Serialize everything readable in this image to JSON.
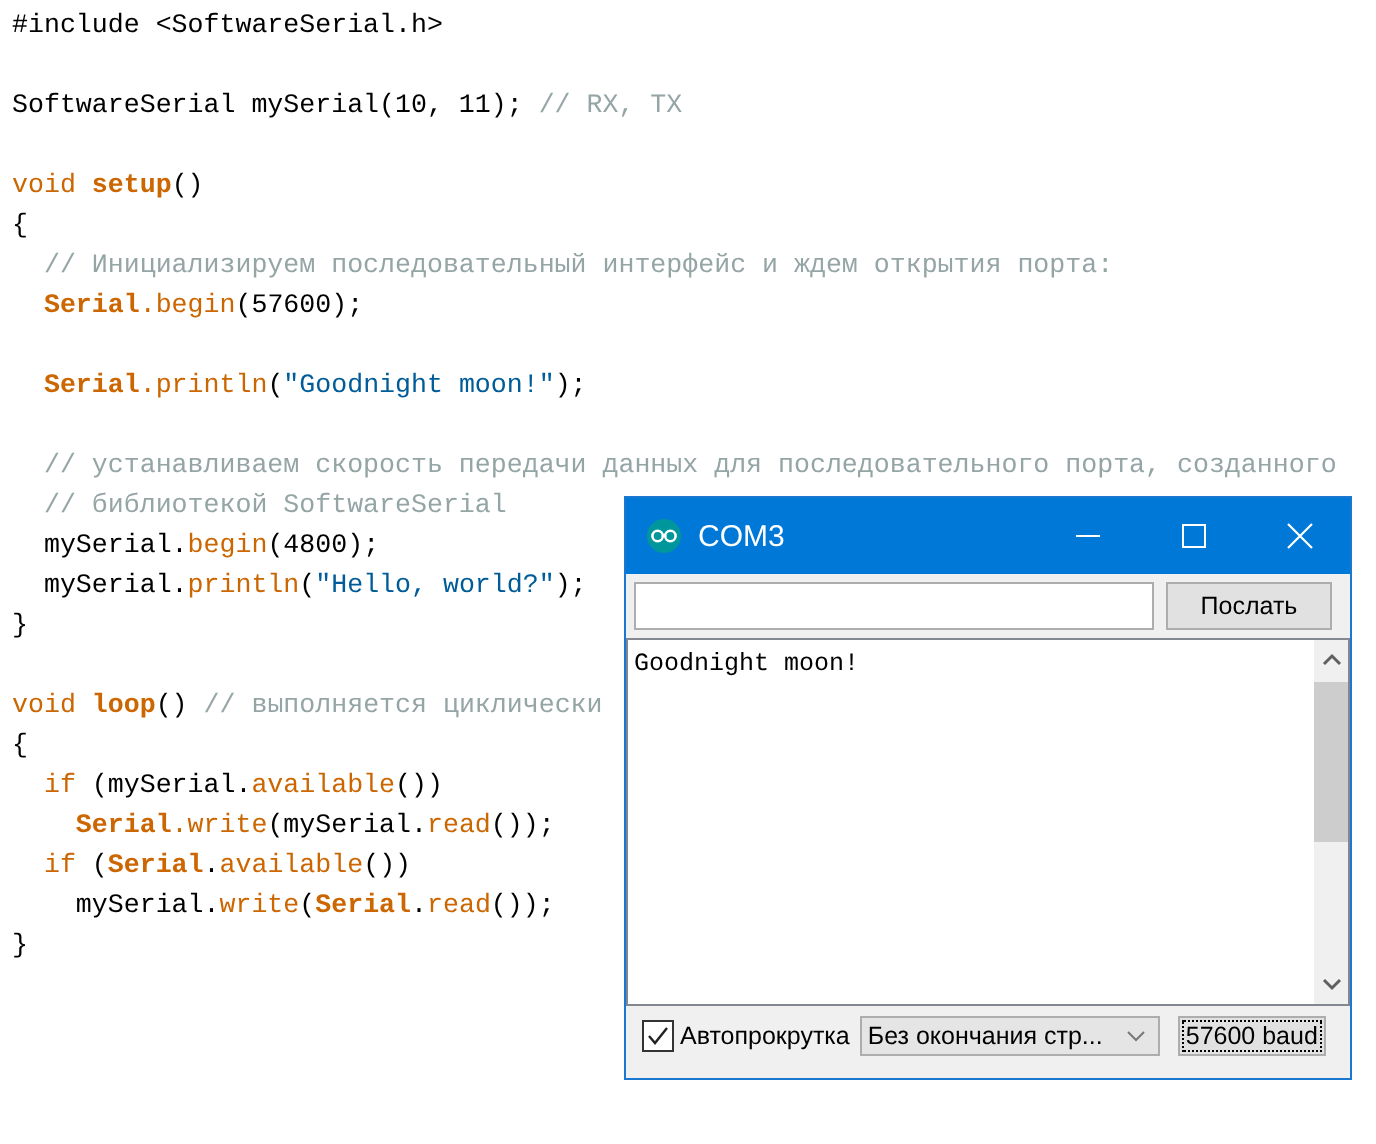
{
  "editor": {
    "lines": [
      {
        "space_before": false,
        "tokens": [
          {
            "kind": "plain",
            "text": "#include <SoftwareSerial.h>"
          }
        ]
      },
      {
        "space_before": true,
        "tokens": [
          {
            "kind": "plain",
            "text": "SoftwareSerial mySerial(10, 11); "
          },
          {
            "kind": "comment",
            "text": "// RX, TX"
          }
        ]
      },
      {
        "space_before": true,
        "tokens": [
          {
            "kind": "keyword",
            "text": "void "
          },
          {
            "kind": "bold",
            "text": "setup"
          },
          {
            "kind": "plain",
            "text": "()"
          }
        ]
      },
      {
        "space_before": false,
        "tokens": [
          {
            "kind": "plain",
            "text": "{"
          }
        ]
      },
      {
        "space_before": false,
        "tokens": [
          {
            "kind": "comment",
            "text": "  // Инициализируем последовательный интерфейс и ждем открытия порта:"
          }
        ]
      },
      {
        "space_before": false,
        "tokens": [
          {
            "kind": "bold",
            "text": "  Serial"
          },
          {
            "kind": "keyword",
            "text": ".begin"
          },
          {
            "kind": "plain",
            "text": "(57600);"
          }
        ]
      },
      {
        "space_before": true,
        "tokens": [
          {
            "kind": "bold",
            "text": "  Serial"
          },
          {
            "kind": "keyword",
            "text": ".println"
          },
          {
            "kind": "plain",
            "text": "("
          },
          {
            "kind": "string",
            "text": "\"Goodnight moon!\""
          },
          {
            "kind": "plain",
            "text": ");"
          }
        ]
      },
      {
        "space_before": true,
        "tokens": [
          {
            "kind": "comment",
            "text": "  // устанавливаем скорость передачи данных для последовательного порта, созданного"
          }
        ]
      },
      {
        "space_before": false,
        "tokens": [
          {
            "kind": "comment",
            "text": "  // библиотекой SoftwareSerial"
          }
        ]
      },
      {
        "space_before": false,
        "tokens": [
          {
            "kind": "plain",
            "text": "  mySerial."
          },
          {
            "kind": "keyword",
            "text": "begin"
          },
          {
            "kind": "plain",
            "text": "(4800);"
          }
        ]
      },
      {
        "space_before": false,
        "tokens": [
          {
            "kind": "plain",
            "text": "  mySerial."
          },
          {
            "kind": "keyword",
            "text": "println"
          },
          {
            "kind": "plain",
            "text": "("
          },
          {
            "kind": "string",
            "text": "\"Hello, world?\""
          },
          {
            "kind": "plain",
            "text": ");"
          }
        ]
      },
      {
        "space_before": false,
        "tokens": [
          {
            "kind": "plain",
            "text": "}"
          }
        ]
      },
      {
        "space_before": true,
        "tokens": [
          {
            "kind": "keyword",
            "text": "void "
          },
          {
            "kind": "bold",
            "text": "loop"
          },
          {
            "kind": "plain",
            "text": "() "
          },
          {
            "kind": "comment",
            "text": "// выполняется циклически"
          }
        ]
      },
      {
        "space_before": false,
        "tokens": [
          {
            "kind": "plain",
            "text": "{"
          }
        ]
      },
      {
        "space_before": false,
        "tokens": [
          {
            "kind": "keyword",
            "text": "  if"
          },
          {
            "kind": "plain",
            "text": " (mySerial."
          },
          {
            "kind": "keyword",
            "text": "available"
          },
          {
            "kind": "plain",
            "text": "())"
          }
        ]
      },
      {
        "space_before": false,
        "tokens": [
          {
            "kind": "bold",
            "text": "    Serial"
          },
          {
            "kind": "keyword",
            "text": ".write"
          },
          {
            "kind": "plain",
            "text": "(mySerial."
          },
          {
            "kind": "keyword",
            "text": "read"
          },
          {
            "kind": "plain",
            "text": "());"
          }
        ]
      },
      {
        "space_before": false,
        "tokens": [
          {
            "kind": "keyword",
            "text": "  if"
          },
          {
            "kind": "plain",
            "text": " ("
          },
          {
            "kind": "bold",
            "text": "Serial"
          },
          {
            "kind": "plain",
            "text": "."
          },
          {
            "kind": "keyword",
            "text": "available"
          },
          {
            "kind": "plain",
            "text": "())"
          }
        ]
      },
      {
        "space_before": false,
        "tokens": [
          {
            "kind": "plain",
            "text": "    mySerial."
          },
          {
            "kind": "keyword",
            "text": "write"
          },
          {
            "kind": "plain",
            "text": "("
          },
          {
            "kind": "bold",
            "text": "Serial"
          },
          {
            "kind": "plain",
            "text": "."
          },
          {
            "kind": "keyword",
            "text": "read"
          },
          {
            "kind": "plain",
            "text": "());"
          }
        ]
      },
      {
        "space_before": false,
        "tokens": [
          {
            "kind": "plain",
            "text": "}"
          }
        ]
      }
    ]
  },
  "serial_monitor": {
    "title": "COM3",
    "send_button": "Послать",
    "output": "Goodnight moon!",
    "autoscroll": {
      "label": "Автопрокрутка",
      "checked": true
    },
    "line_ending": "Без окончания стр...",
    "baud": "57600 baud"
  }
}
